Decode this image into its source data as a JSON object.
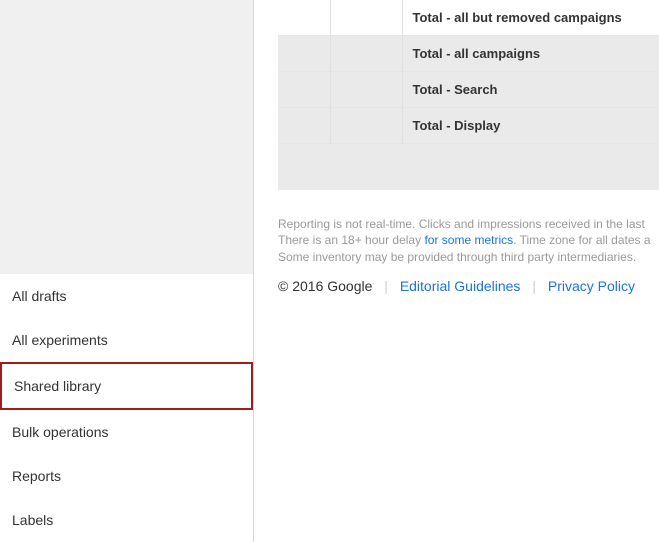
{
  "sidebar": {
    "items": [
      {
        "label": "All drafts",
        "highlighted": false
      },
      {
        "label": "All experiments",
        "highlighted": false
      },
      {
        "label": "Shared library",
        "highlighted": true
      },
      {
        "label": "Bulk operations",
        "highlighted": false
      },
      {
        "label": "Reports",
        "highlighted": false
      },
      {
        "label": "Labels",
        "highlighted": false
      }
    ]
  },
  "table": {
    "rows": [
      {
        "label": "Total - all but removed campaigns",
        "shaded": false
      },
      {
        "label": "Total - all campaigns",
        "shaded": true
      },
      {
        "label": "Total - Search",
        "shaded": true
      },
      {
        "label": "Total - Display",
        "shaded": true
      }
    ]
  },
  "disclaimer": {
    "line1a": "Reporting is not real-time. Clicks and impressions received in the last",
    "line2a": "There is an 18+ hour delay ",
    "link": "for some metrics",
    "line2b": ". Time zone for all dates a",
    "line3": "Some inventory may be provided through third party intermediaries."
  },
  "footer": {
    "copyright": "© 2016 Google",
    "links": [
      {
        "label": "Editorial Guidelines"
      },
      {
        "label": "Privacy Policy"
      }
    ]
  }
}
